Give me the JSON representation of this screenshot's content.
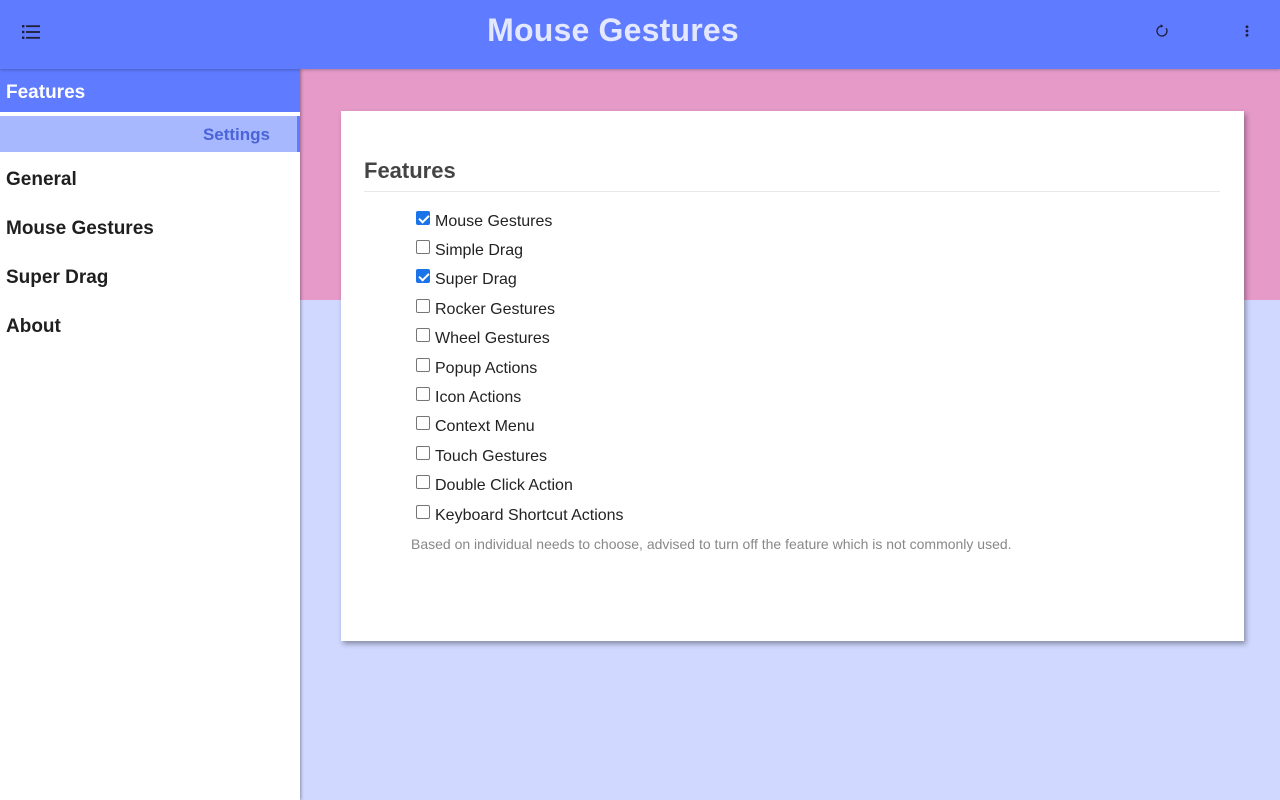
{
  "header": {
    "title": "Mouse Gestures",
    "menu_icon": "menu-list-icon",
    "refresh_icon": "refresh-icon",
    "more_icon": "more-vert-icon",
    "bar_color": "#5f7bff"
  },
  "sidebar": {
    "header": "Features",
    "subitem": "Settings",
    "items": [
      {
        "label": "General"
      },
      {
        "label": "Mouse Gestures"
      },
      {
        "label": "Super Drag"
      },
      {
        "label": "About"
      }
    ]
  },
  "main": {
    "title": "Features",
    "features": [
      {
        "label": "Mouse Gestures",
        "checked": true
      },
      {
        "label": "Simple Drag",
        "checked": false
      },
      {
        "label": "Super Drag",
        "checked": true
      },
      {
        "label": "Rocker Gestures",
        "checked": false
      },
      {
        "label": "Wheel Gestures",
        "checked": false
      },
      {
        "label": "Popup Actions",
        "checked": false
      },
      {
        "label": "Icon Actions",
        "checked": false
      },
      {
        "label": "Context Menu",
        "checked": false
      },
      {
        "label": "Touch Gestures",
        "checked": false
      },
      {
        "label": "Double Click Action",
        "checked": false
      },
      {
        "label": "Keyboard Shortcut Actions",
        "checked": false
      }
    ],
    "hint": "Based on individual needs to choose, advised to turn off the feature which is not commonly used."
  },
  "colors": {
    "accent": "#5f7bff",
    "pink_band": "#e59ac8",
    "background": "#d0d8ff",
    "checkbox_checked": "#1a73e8"
  }
}
